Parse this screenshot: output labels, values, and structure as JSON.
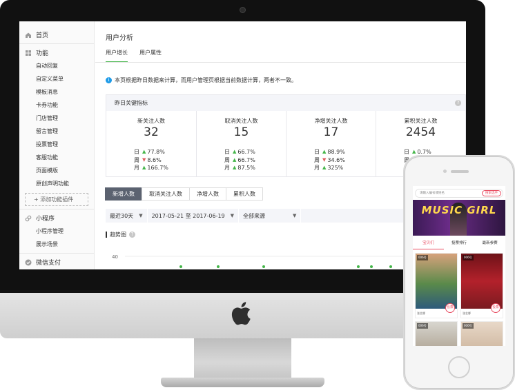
{
  "sidebar": {
    "home": "首页",
    "features_group": "功能",
    "features": [
      "自动回复",
      "自定义菜单",
      "模板消息",
      "卡券功能",
      "门店管理",
      "留言管理",
      "投票管理",
      "客服功能",
      "页面模版",
      "原创声明功能"
    ],
    "add_plugin": "添加功能插件",
    "mini_group": "小程序",
    "mini_items": [
      "小程序管理",
      "展示场景"
    ],
    "next_group": "微信支付"
  },
  "header": {
    "title": "用户分析",
    "tabs": [
      {
        "label": "用户增长",
        "active": true
      },
      {
        "label": "用户属性",
        "active": false
      }
    ]
  },
  "notice": "本页根据昨日数据来计算，而用户管理页根据当前数据计算，两者不一致。",
  "kpi": {
    "title": "昨日关键指标",
    "items": [
      {
        "label": "新关注人数",
        "value": "32",
        "trends": [
          {
            "period": "日",
            "dir": "up",
            "value": "77.8%"
          },
          {
            "period": "周",
            "dir": "down",
            "value": "8.6%"
          },
          {
            "period": "月",
            "dir": "up",
            "value": "166.7%"
          }
        ]
      },
      {
        "label": "取消关注人数",
        "value": "15",
        "trends": [
          {
            "period": "日",
            "dir": "up",
            "value": "66.7%"
          },
          {
            "period": "周",
            "dir": "up",
            "value": "66.7%"
          },
          {
            "period": "月",
            "dir": "up",
            "value": "87.5%"
          }
        ]
      },
      {
        "label": "净增关注人数",
        "value": "17",
        "trends": [
          {
            "period": "日",
            "dir": "up",
            "value": "88.9%"
          },
          {
            "period": "周",
            "dir": "down",
            "value": "34.6%"
          },
          {
            "period": "月",
            "dir": "up",
            "value": "325%"
          }
        ]
      },
      {
        "label": "累积关注人数",
        "value": "2454",
        "trends": [
          {
            "period": "日",
            "dir": "up",
            "value": "0.7%"
          },
          {
            "period": "周",
            "dir": "",
            "value": ""
          },
          {
            "period": "月",
            "dir": "",
            "value": ""
          }
        ]
      }
    ]
  },
  "metric_tabs": [
    {
      "label": "新增人数",
      "active": true
    },
    {
      "label": "取消关注人数",
      "active": false
    },
    {
      "label": "净增人数",
      "active": false
    },
    {
      "label": "累积人数",
      "active": false
    }
  ],
  "filters": {
    "range": "最近30天",
    "dates": "2017-05-21 至 2017-06-19",
    "source": "全部来源"
  },
  "trend_title": "趋势图",
  "chart": {
    "y_tick": "40"
  },
  "phone": {
    "search_placeholder": "请输入编号或姓名",
    "search_button": "搜索选手",
    "banner_text": "MUSIC GIRL",
    "tabs": [
      {
        "label": "宝贝们",
        "active": true
      },
      {
        "label": "投票排行",
        "active": false
      },
      {
        "label": "最新参赛",
        "active": false
      }
    ],
    "cards": [
      {
        "no": "006号",
        "name": "张艺娜",
        "vote": "投票"
      },
      {
        "no": "006号",
        "name": "张艺娜",
        "vote": "投票"
      },
      {
        "no": "006号",
        "name": "",
        "vote": ""
      },
      {
        "no": "006号",
        "name": "",
        "vote": ""
      }
    ]
  },
  "colors": {
    "accent": "#44b549",
    "down": "#e15f63",
    "brand_phone": "#e84a5f"
  }
}
